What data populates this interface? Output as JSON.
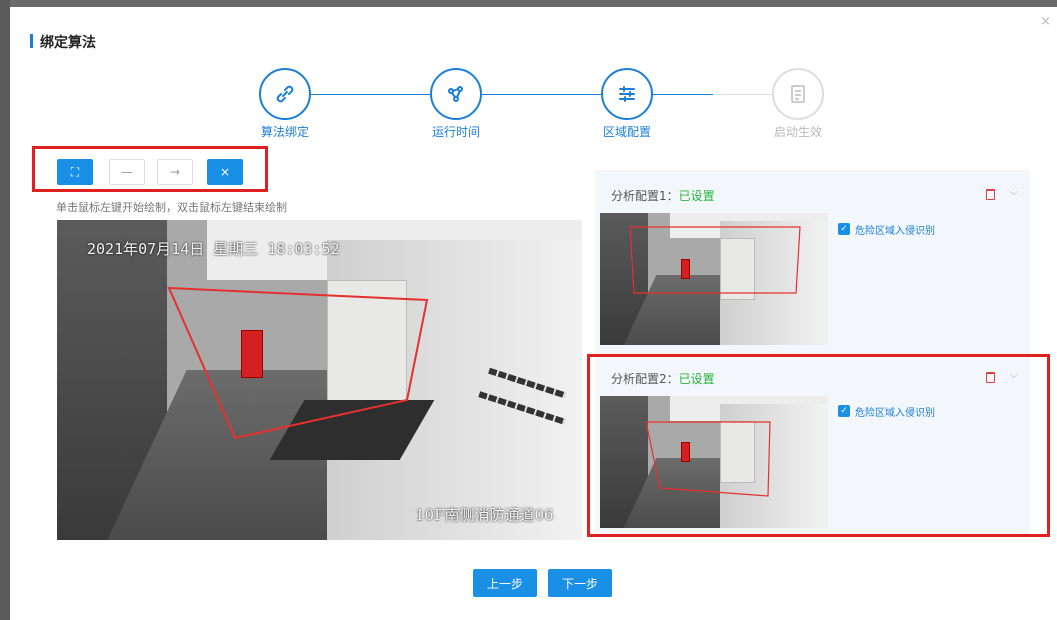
{
  "dialog": {
    "title": "绑定算法",
    "close_label": "×"
  },
  "steps": [
    {
      "label": "算法绑定",
      "icon": "link-icon",
      "state": "done"
    },
    {
      "label": "运行时间",
      "icon": "schedule-icon",
      "state": "done"
    },
    {
      "label": "区域配置",
      "icon": "sliders-icon",
      "state": "active"
    },
    {
      "label": "启动生效",
      "icon": "document-icon",
      "state": "pending"
    }
  ],
  "toolbar": {
    "fullscreen_label": "⛶",
    "line_label": "—",
    "arrow_label": "→",
    "clear_label": "×"
  },
  "hint": "单击鼠标左键开始绘制，双击鼠标左键结束绘制",
  "camera": {
    "timestamp": "2021年07月14日 星期三 18:03:52",
    "location": "10F南侧消防通道06"
  },
  "configs": [
    {
      "title": "分析配置1：",
      "status": "已设置",
      "option_label": "危险区域入侵识别",
      "checked": true
    },
    {
      "title": "分析配置2：",
      "status": "已设置",
      "option_label": "危险区域入侵识别",
      "checked": true
    }
  ],
  "footer": {
    "prev_label": "上一步",
    "next_label": "下一步"
  },
  "colors": {
    "accent": "#1a8fe6",
    "status_ok": "#28b43c",
    "highlight": "#e02020"
  }
}
